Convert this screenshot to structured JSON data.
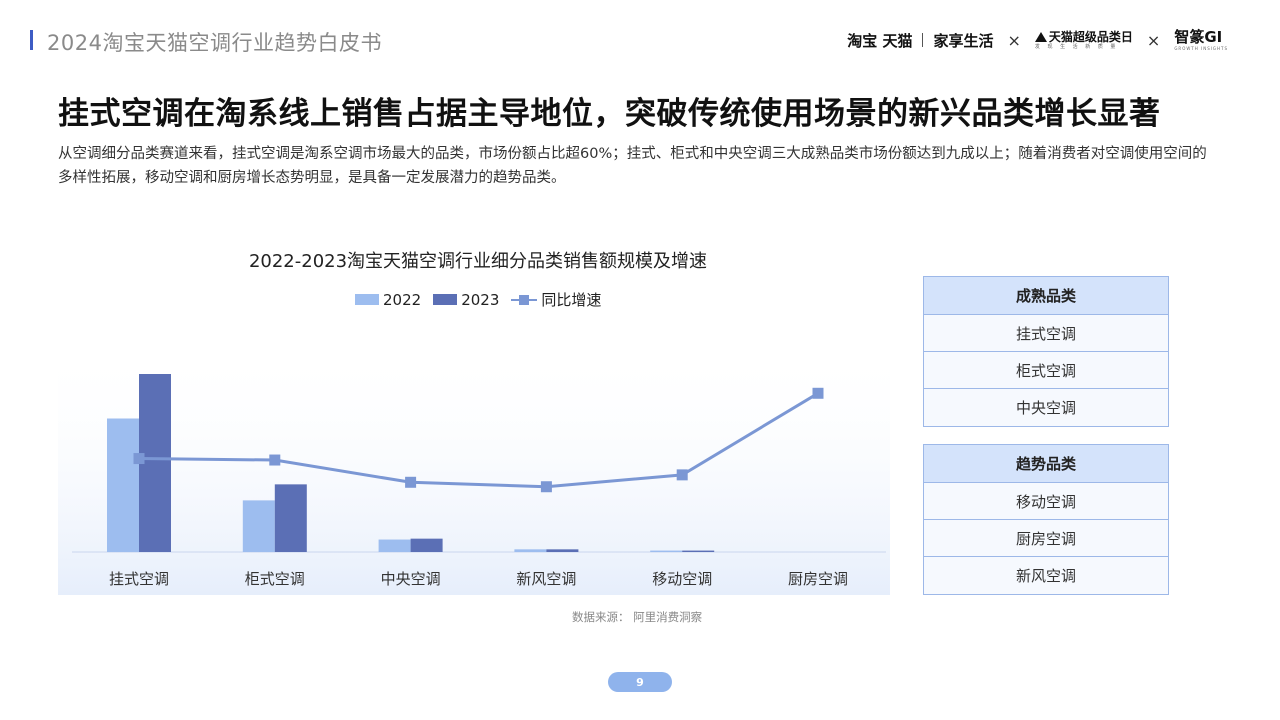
{
  "header": {
    "title": "2024淘宝天猫空调行业趋势白皮书",
    "logos": {
      "taobao_tmall": "淘宝 天猫",
      "home_life": "家享生活",
      "super_day": "天猫超级品类日",
      "super_day_sub": "发 现 生 活 新 质 量",
      "gi": "智篆GI",
      "gi_sub": "GROWTH INSIGHTS",
      "separator": "×"
    }
  },
  "main_title": "挂式空调在淘系线上销售占据主导地位，突破传统使用场景的新兴品类增长显著",
  "description": "从空调细分品类赛道来看，挂式空调是淘系空调市场最大的品类，市场份额占比超60%；挂式、柜式和中央空调三大成熟品类市场份额达到九成以上；随着消费者对空调使用空间的多样性拓展，移动空调和厨房增长态势明显，是具备一定发展潜力的趋势品类。",
  "chart_data": {
    "type": "bar",
    "title": "2022-2023淘宝天猫空调行业细分品类销售额规模及增速",
    "categories": [
      "挂式空调",
      "柜式空调",
      "中央空调",
      "新风空调",
      "移动空调",
      "厨房空调"
    ],
    "series": [
      {
        "name": "2022",
        "kind": "bar",
        "color": "#9dbdef",
        "values": [
          75,
          29,
          7,
          1.5,
          0.8,
          0
        ]
      },
      {
        "name": "2023",
        "kind": "bar",
        "color": "#5b6fb5",
        "values": [
          100,
          38,
          7.5,
          1.5,
          0.8,
          0
        ]
      },
      {
        "name": "同比增速",
        "kind": "line",
        "color": "#7b97d4",
        "values": [
          43,
          42,
          27,
          24,
          32,
          87
        ]
      }
    ],
    "bar_axis_max": 100,
    "line_axis_range": [
      -20,
      100
    ],
    "legend_position": "top-center",
    "grid": false
  },
  "source": "数据来源：  阿里消费洞察",
  "mature_box": {
    "heading": "成熟品类",
    "items": [
      "挂式空调",
      "柜式空调",
      "中央空调"
    ]
  },
  "trend_box": {
    "heading": "趋势品类",
    "items": [
      "移动空调",
      "厨房空调",
      "新风空调"
    ]
  },
  "page_number": "9"
}
